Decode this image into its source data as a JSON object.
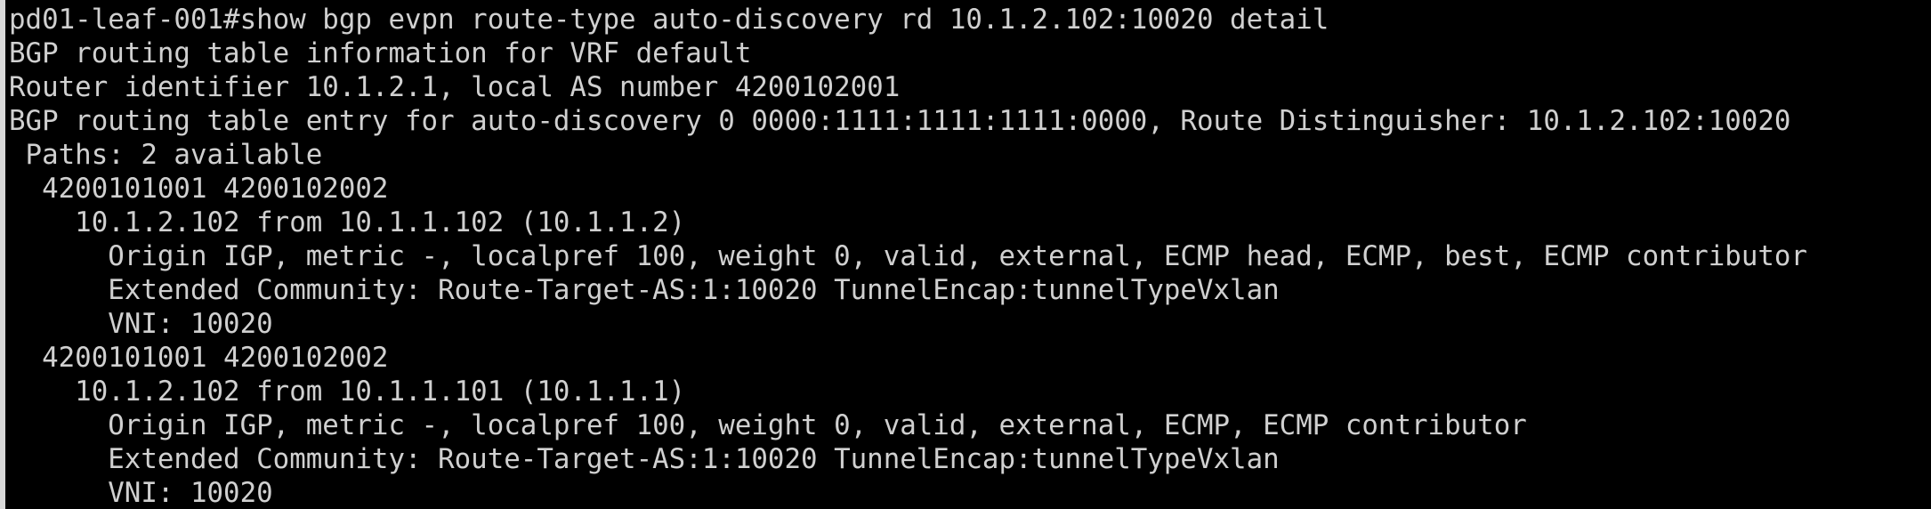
{
  "terminal": {
    "lines": [
      "pd01-leaf-001#show bgp evpn route-type auto-discovery rd 10.1.2.102:10020 detail",
      "BGP routing table information for VRF default",
      "Router identifier 10.1.2.1, local AS number 4200102001",
      "BGP routing table entry for auto-discovery 0 0000:1111:1111:1111:0000, Route Distinguisher: 10.1.2.102:10020",
      " Paths: 2 available",
      "  4200101001 4200102002",
      "    10.1.2.102 from 10.1.1.102 (10.1.1.2)",
      "      Origin IGP, metric -, localpref 100, weight 0, valid, external, ECMP head, ECMP, best, ECMP contributor",
      "      Extended Community: Route-Target-AS:1:10020 TunnelEncap:tunnelTypeVxlan",
      "      VNI: 10020",
      "  4200101001 4200102002",
      "    10.1.2.102 from 10.1.1.101 (10.1.1.1)",
      "      Origin IGP, metric -, localpref 100, weight 0, valid, external, ECMP, ECMP contributor",
      "      Extended Community: Route-Target-AS:1:10020 TunnelEncap:tunnelTypeVxlan",
      "      VNI: 10020"
    ]
  }
}
